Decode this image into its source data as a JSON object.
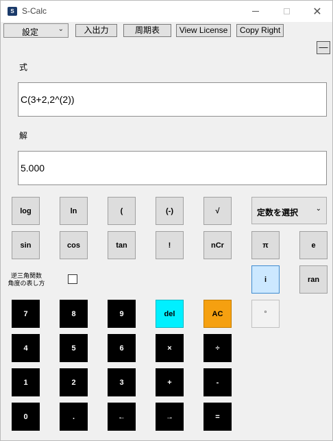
{
  "window": {
    "title": "S-Calc",
    "app_icon_text": "S"
  },
  "toolbar": {
    "settings_label": "設定",
    "io_label": "入出力",
    "periodic_label": "周期表",
    "license_label": "View License",
    "copyright_label": "Copy Right",
    "collapse_label": "—"
  },
  "expression": {
    "label": "式",
    "value": "C(3+2,2^(2))"
  },
  "answer": {
    "label": "解",
    "value": "5.000"
  },
  "functions": {
    "log": "log",
    "ln": "ln",
    "lparen": "(",
    "neg": "(-)",
    "sqrt": "√",
    "sin": "sin",
    "cos": "cos",
    "tan": "tan",
    "fact": "!",
    "ncr": "nCr",
    "pi": "π",
    "e": "e",
    "i": "i",
    "ran": "ran",
    "deg": "°"
  },
  "constants": {
    "placeholder": "定数を選択"
  },
  "options": {
    "inverse_label_1": "逆三角関数",
    "inverse_label_2": "角度の表し方",
    "inverse_checked": false
  },
  "keypad": {
    "k7": "7",
    "k8": "8",
    "k9": "9",
    "del": "del",
    "ac": "AC",
    "k4": "4",
    "k5": "5",
    "k6": "6",
    "mul": "×",
    "div": "÷",
    "k1": "1",
    "k2": "2",
    "k3": "3",
    "add": "+",
    "sub": "-",
    "k0": "0",
    "dot": ".",
    "left": "←",
    "right": "→",
    "eq": "="
  },
  "colors": {
    "del_key": "#00f0ff",
    "ac_key": "#f5a010",
    "digit_key": "#000000",
    "selected_key": "#cce8ff"
  }
}
